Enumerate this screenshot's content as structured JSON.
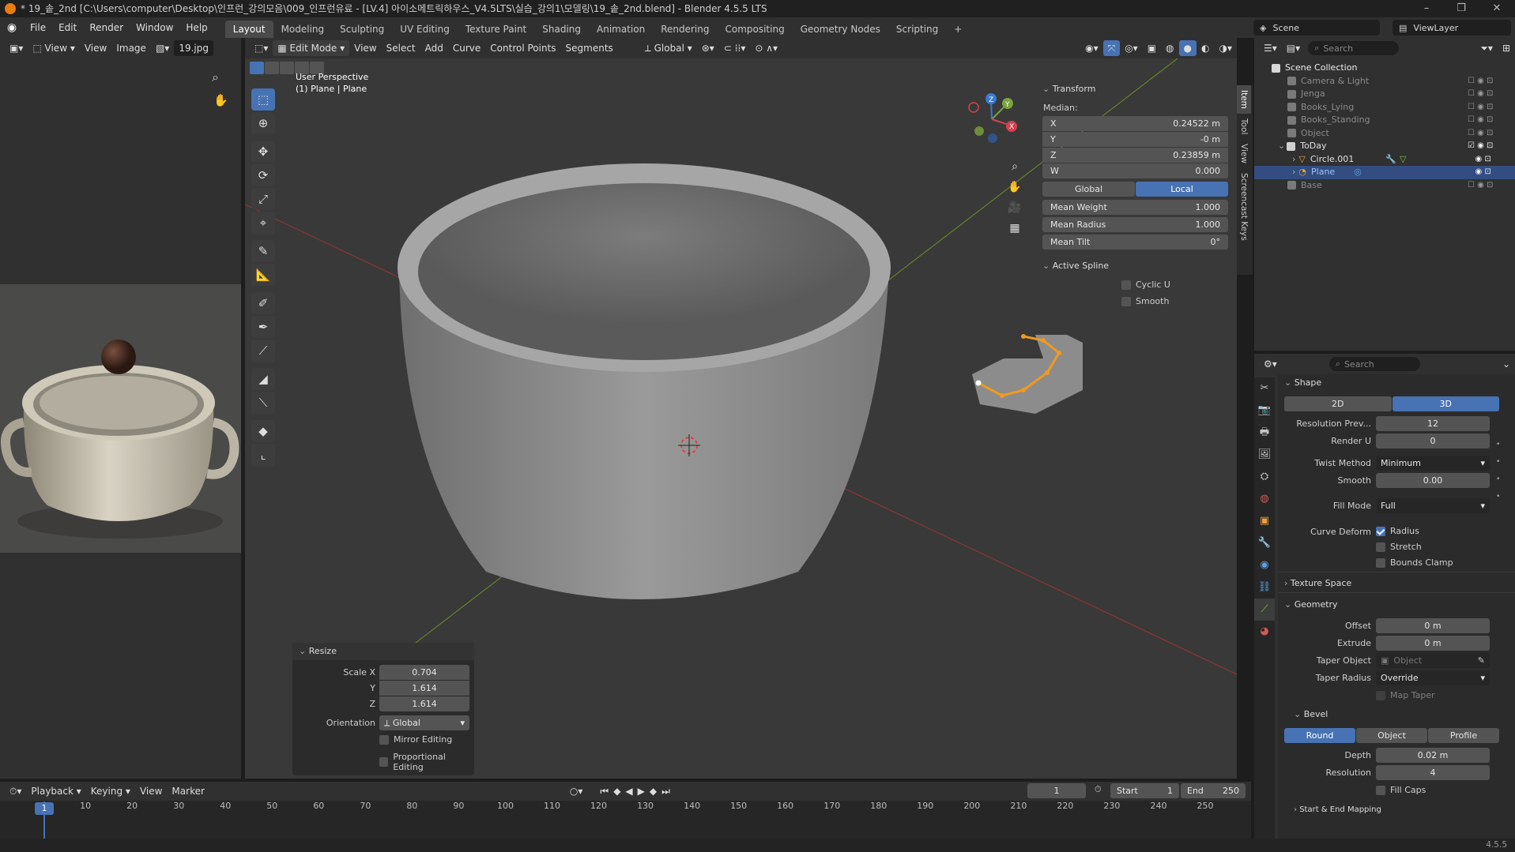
{
  "title": "* 19_솥_2nd [C:\\Users\\computer\\Desktop\\인프런_강의모음\\009_인프런유료 - [LV.4] 아이소메트릭하우스_V4.5LTS\\실습_강의1\\모델링\\19_솥_2nd.blend] - Blender 4.5.5 LTS",
  "menu": [
    "File",
    "Edit",
    "Render",
    "Window",
    "Help"
  ],
  "workspaces": [
    "Layout",
    "Modeling",
    "Sculpting",
    "UV Editing",
    "Texture Paint",
    "Shading",
    "Animation",
    "Rendering",
    "Compositing",
    "Geometry Nodes",
    "Scripting",
    "+"
  ],
  "scene_label": "Scene",
  "viewlayer_label": "ViewLayer",
  "image_editor": {
    "menus": [
      "View",
      "View",
      "Image"
    ],
    "image_name": "19.jpg"
  },
  "viewport_header": {
    "mode": "Edit Mode",
    "menus": [
      "View",
      "Select",
      "Add",
      "Curve",
      "Control Points",
      "Segments"
    ],
    "orientation": "Global"
  },
  "viewport_info": {
    "line1": "User Perspective",
    "line2": "(1) Plane | Plane"
  },
  "gizmo": {
    "z": "Z",
    "y": "Y",
    "x": "X"
  },
  "transform_panel": {
    "title": "Transform",
    "median_label": "Median:",
    "rows": [
      {
        "label": "X",
        "value": "0.24522 m"
      },
      {
        "label": "Y",
        "value": "-0 m"
      },
      {
        "label": "Z",
        "value": "0.23859 m"
      },
      {
        "label": "W",
        "value": "0.000"
      }
    ],
    "space": [
      "Global",
      "Local"
    ],
    "mean_rows": [
      {
        "label": "Mean Weight",
        "value": "1.000"
      },
      {
        "label": "Mean Radius",
        "value": "1.000"
      },
      {
        "label": "Mean Tilt",
        "value": "0°"
      }
    ],
    "active_spline": "Active Spline",
    "cyclic": "Cyclic U",
    "smooth": "Smooth"
  },
  "side_tabs": [
    "Item",
    "Tool",
    "View",
    "Screencast Keys"
  ],
  "resize_panel": {
    "title": "Resize",
    "scale_label": "Scale X",
    "rows": [
      {
        "label": "Scale X",
        "value": "0.704"
      },
      {
        "label": "Y",
        "value": "1.614"
      },
      {
        "label": "Z",
        "value": "1.614"
      }
    ],
    "orientation_label": "Orientation",
    "orientation": "Global",
    "mirror": "Mirror Editing",
    "proportional": "Proportional Editing"
  },
  "outliner": {
    "search_placeholder": "Search",
    "root": "Scene Collection",
    "items": [
      {
        "name": "Camera & Light",
        "indent": 1,
        "dim": true
      },
      {
        "name": "Jenga",
        "indent": 1,
        "dim": true
      },
      {
        "name": "Books_Lying",
        "indent": 1,
        "dim": true
      },
      {
        "name": "Books_Standing",
        "indent": 1,
        "dim": true
      },
      {
        "name": "Object",
        "indent": 1,
        "dim": true
      },
      {
        "name": "ToDay",
        "indent": 1,
        "dim": false
      },
      {
        "name": "Circle.001",
        "indent": 2,
        "dim": false
      },
      {
        "name": "Plane",
        "indent": 2,
        "dim": false,
        "selected": true
      },
      {
        "name": "Base",
        "indent": 1,
        "dim": true
      }
    ]
  },
  "properties": {
    "search_placeholder": "Search",
    "shape": "Shape",
    "dim2d": "2D",
    "dim3d": "3D",
    "resolution_preview_label": "Resolution Prev...",
    "resolution_preview": "12",
    "render_u_label": "Render U",
    "render_u": "0",
    "twist_method_label": "Twist Method",
    "twist_method": "Minimum",
    "smooth_label": "Smooth",
    "smooth": "0.00",
    "fill_mode_label": "Fill Mode",
    "fill_mode": "Full",
    "curve_deform_label": "Curve Deform",
    "radius": "Radius",
    "stretch": "Stretch",
    "bounds_clamp": "Bounds Clamp",
    "texture_space": "Texture Space",
    "geometry": "Geometry",
    "offset_label": "Offset",
    "offset": "0 m",
    "extrude_label": "Extrude",
    "extrude": "0 m",
    "taper_object_label": "Taper Object",
    "taper_object_placeholder": "Object",
    "taper_radius_label": "Taper Radius",
    "taper_radius": "Override",
    "map_taper": "Map Taper",
    "bevel": "Bevel",
    "bevel_modes": [
      "Round",
      "Object",
      "Profile"
    ],
    "depth_label": "Depth",
    "depth": "0.02 m",
    "resolution_label": "Resolution",
    "resolution": "4",
    "fill_caps": "Fill Caps",
    "start_end": "Start & End Mapping"
  },
  "timeline": {
    "menus": [
      "Playback",
      "Keying",
      "View",
      "Marker"
    ],
    "current_frame": "1",
    "start_label": "Start",
    "start": "1",
    "end_label": "End",
    "end": "250",
    "ticks": [
      "1",
      "10",
      "20",
      "30",
      "40",
      "50",
      "60",
      "70",
      "80",
      "90",
      "100",
      "110",
      "120",
      "130",
      "140",
      "150",
      "160",
      "170",
      "180",
      "190",
      "200",
      "210",
      "220",
      "230",
      "240",
      "250"
    ]
  },
  "version": "4.5.5",
  "colors": {
    "accent": "#4772b3",
    "active_curve": "#f09a20",
    "bg": "#303030"
  }
}
